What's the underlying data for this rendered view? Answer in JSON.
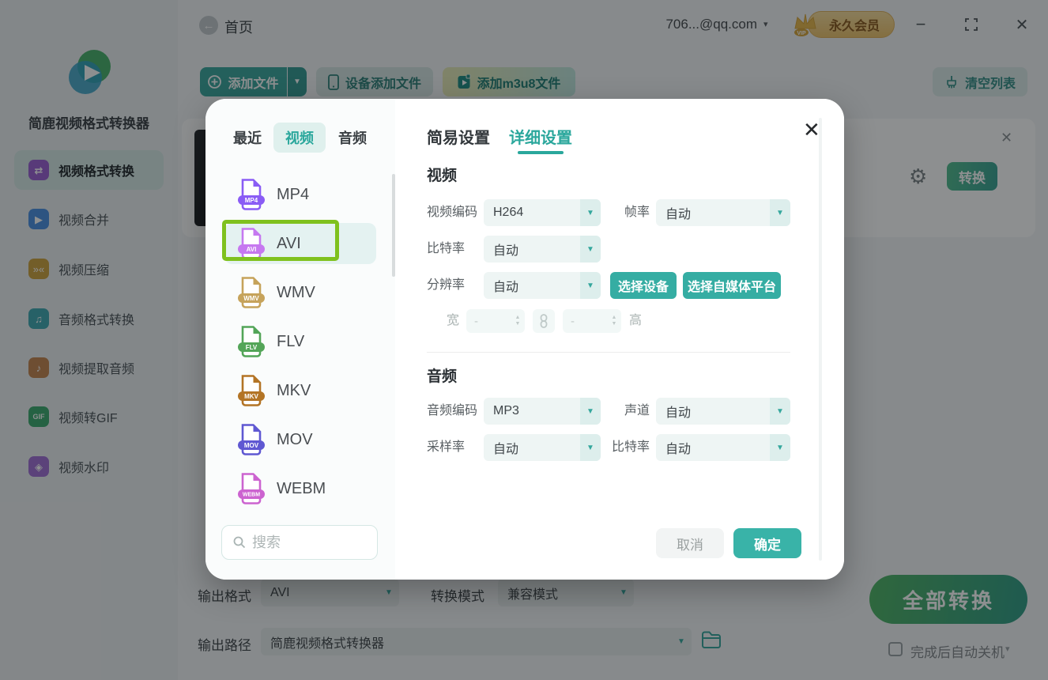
{
  "titlebar": {
    "home": "首页",
    "account": "706...@qq.com",
    "vip": "永久会员"
  },
  "sidebar": {
    "app_name": "简鹿视频格式转换器",
    "items": [
      {
        "label": "视频格式转换",
        "glyph": "⇄",
        "color": "#9c5fd4",
        "active": true
      },
      {
        "label": "视频合并",
        "glyph": "▶",
        "color": "#4a90e2"
      },
      {
        "label": "视频压缩",
        "glyph": "»«",
        "color": "#cfa23e"
      },
      {
        "label": "音频格式转换",
        "glyph": "♫",
        "color": "#3fa8b2"
      },
      {
        "label": "视频提取音频",
        "glyph": "♪",
        "color": "#c5854f"
      },
      {
        "label": "视频转GIF",
        "glyph": "GIF",
        "color": "#3cab6e"
      },
      {
        "label": "视频水印",
        "glyph": "◈",
        "color": "#a06fd6"
      }
    ]
  },
  "toolbar": {
    "add_file": "添加文件",
    "add_from_device": "设备添加文件",
    "add_m3u8": "添加m3u8文件",
    "clear_list": "清空列表"
  },
  "file_card": {
    "convert": "转换"
  },
  "footer": {
    "output_format_label": "输出格式",
    "output_format_value": "AVI",
    "convert_mode_label": "转换模式",
    "convert_mode_value": "兼容模式",
    "output_path_label": "输出路径",
    "output_path_value": "简鹿视频格式转换器",
    "convert_all": "全部转换",
    "auto_shutdown": "完成后自动关机"
  },
  "modal": {
    "tabs": {
      "recent": "最近",
      "video": "视频",
      "audio": "音频"
    },
    "formats": [
      {
        "label": "MP4",
        "color": "#8a5cf5"
      },
      {
        "label": "AVI",
        "color": "#c678f0",
        "selected": true
      },
      {
        "label": "WMV",
        "color": "#c6a35b"
      },
      {
        "label": "FLV",
        "color": "#53a558"
      },
      {
        "label": "MKV",
        "color": "#b37425"
      },
      {
        "label": "MOV",
        "color": "#5f58d2"
      },
      {
        "label": "WEBM",
        "color": "#cc63d0"
      }
    ],
    "search_placeholder": "搜索",
    "settings": {
      "tab_simple": "简易设置",
      "tab_detail": "详细设置",
      "section_video": "视频",
      "video_codec_label": "视频编码",
      "video_codec_value": "H264",
      "fps_label": "帧率",
      "fps_value": "自动",
      "bitrate_label": "比特率",
      "bitrate_value": "自动",
      "resolution_label": "分辨率",
      "resolution_value": "自动",
      "select_device": "选择设备",
      "select_platform": "选择自媒体平台",
      "width_label": "宽",
      "height_label": "高",
      "dim_placeholder": "-",
      "section_audio": "音频",
      "audio_codec_label": "音频编码",
      "audio_codec_value": "MP3",
      "channels_label": "声道",
      "channels_value": "自动",
      "sample_rate_label": "采样率",
      "sample_rate_value": "自动",
      "audio_bitrate_label": "比特率",
      "audio_bitrate_value": "自动",
      "cancel": "取消",
      "ok": "确定"
    }
  },
  "colors": {
    "accent": "#35ada3",
    "accent_text": "#2aa79c",
    "highlight_green": "#7fc11e"
  }
}
